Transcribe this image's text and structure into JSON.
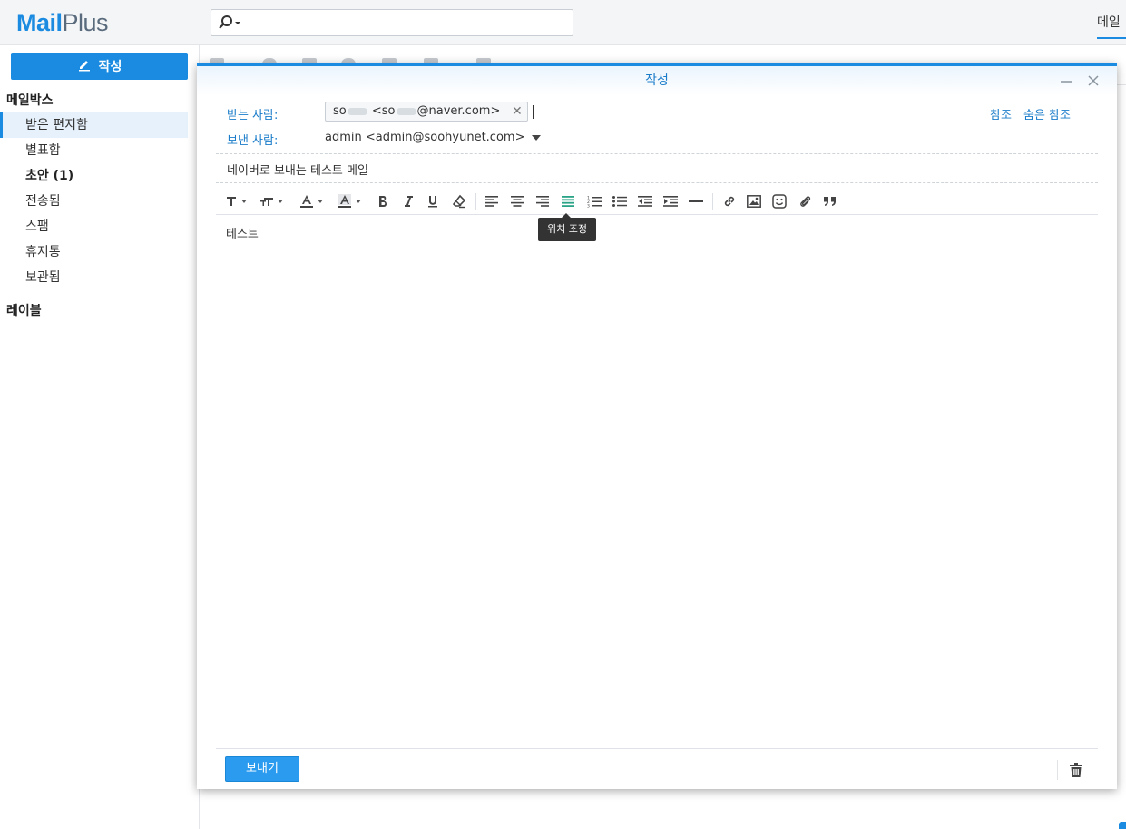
{
  "app": {
    "logo_bold": "Mail",
    "logo_light": "Plus"
  },
  "search": {
    "placeholder": ""
  },
  "top_tab": {
    "label": "메일"
  },
  "sidebar": {
    "compose_label": "작성",
    "mailbox_header": "메일박스",
    "items": [
      {
        "label": "받은 편지함",
        "active": true
      },
      {
        "label": "별표함"
      },
      {
        "label": "초안 (1)",
        "bold": true
      },
      {
        "label": "전송됨"
      },
      {
        "label": "스팸"
      },
      {
        "label": "휴지통"
      },
      {
        "label": "보관됨"
      }
    ],
    "labels_header": "레이블"
  },
  "compose": {
    "title": "작성",
    "to_label": "받는 사람:",
    "to_chip": {
      "p1": "so",
      "p2": " <so",
      "p3": "@naver.com>"
    },
    "cc_label": "참조",
    "bcc_label": "숨은 참조",
    "from_label": "보낸 사람:",
    "from_value": "admin <admin@soohyunet.com>",
    "subject": "네이버로 보내는 테스트 메일",
    "body": "테스트",
    "tooltip": "위치 조정",
    "send_label": "보내기"
  },
  "colors": {
    "accent": "#1a8be0",
    "label_blue": "#1a7cc9",
    "justify_active": "#2aa386"
  },
  "toolbar_icons": [
    "font-icon",
    "font-size-icon",
    "font-color-icon",
    "background-color-icon",
    "bold-icon",
    "italic-icon",
    "underline-icon",
    "clear-format-icon",
    "align-left-icon",
    "align-center-icon",
    "align-right-icon",
    "align-justify-icon",
    "numbered-list-icon",
    "bullet-list-icon",
    "outdent-icon",
    "indent-icon",
    "horizontal-rule-icon",
    "link-icon",
    "image-icon",
    "emoji-icon",
    "attachment-icon",
    "quote-icon"
  ]
}
